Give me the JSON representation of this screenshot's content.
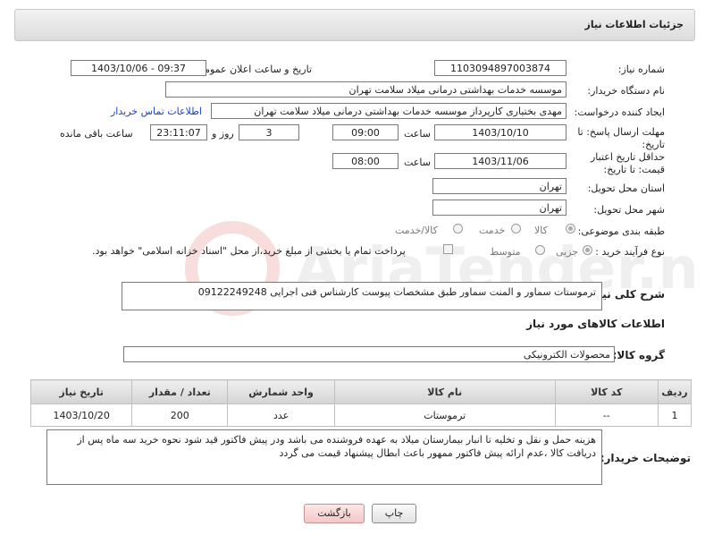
{
  "header": {
    "title": "جزئیات اطلاعات نیاز"
  },
  "fields": {
    "need_number_label": "شماره نیاز:",
    "need_number": "1103094897003874",
    "announce_label": "تاریخ و ساعت اعلان عمومی:",
    "announce_value": "1403/10/06 - 09:37",
    "buyer_org_label": "نام دستگاه خریدار:",
    "buyer_org": "موسسه خدمات بهداشتی درمانی میلاد سلامت تهران",
    "creator_label": "ایجاد کننده درخواست:",
    "creator": "مهدی بختیاری کارپرداز موسسه خدمات بهداشتی درمانی میلاد سلامت تهران",
    "contact_link": "اطلاعات تماس خریدار",
    "reply_deadline_label": "مهلت ارسال پاسخ: تا تاریخ:",
    "reply_date": "1403/10/10",
    "time_label": "ساعت",
    "reply_time": "09:00",
    "days": "3",
    "days_label": "روز و",
    "remaining_time": "23:11:07",
    "remaining_label": "ساعت باقی مانده",
    "price_validity_label": "حداقل تاریخ اعتبار قیمت: تا تاریخ:",
    "price_date": "1403/11/06",
    "price_time": "08:00",
    "province_label": "استان محل تحویل:",
    "province": "تهران",
    "city_label": "شهر محل تحویل:",
    "city": "تهران",
    "category_label": "طبقه بندی موضوعی:",
    "category_options": [
      "کالا",
      "خدمت",
      "کالا/خدمت"
    ],
    "process_label": "نوع فرآیند خرید :",
    "process_options": [
      "جزیی",
      "متوسط"
    ],
    "payment_note": "پرداخت تمام یا بخشی از مبلغ خرید،از محل \"اسناد خزانه اسلامی\" خواهد بود.",
    "description_label": "شرح کلی نیاز:",
    "description": "ترموستات سماور و المنت سماور طبق مشخصات پیوست کارشناس فنی اجرایی 09122249248",
    "goods_info_title": "اطلاعات کالاهای مورد نیاز",
    "goods_group_label": "گروه کالا:",
    "goods_group": "محصولات الکترونیکی"
  },
  "table": {
    "headers": [
      "ردیف",
      "کد کالا",
      "نام کالا",
      "واحد شمارش",
      "تعداد / مقدار",
      "تاریخ نیاز"
    ],
    "rows": [
      [
        "1",
        "--",
        "ترموستات",
        "عدد",
        "200",
        "1403/10/20"
      ]
    ]
  },
  "buyer_notes": {
    "label": "توضیحات خریدار:",
    "text": "هزینه حمل و نقل و تخلیه تا انبار بیمارستان میلاد به عهده فروشنده می باشد ودر پیش فاکتور قید شود نحوه خرید سه ماه پس از دریافت کالا ،عدم ارائه پیش فاکتور ممهور باعث ابطال پیشنهاد قیمت می گردد"
  },
  "buttons": {
    "print": "چاپ",
    "back": "بازگشت"
  },
  "watermark": {
    "text": "AriaTender.net"
  }
}
